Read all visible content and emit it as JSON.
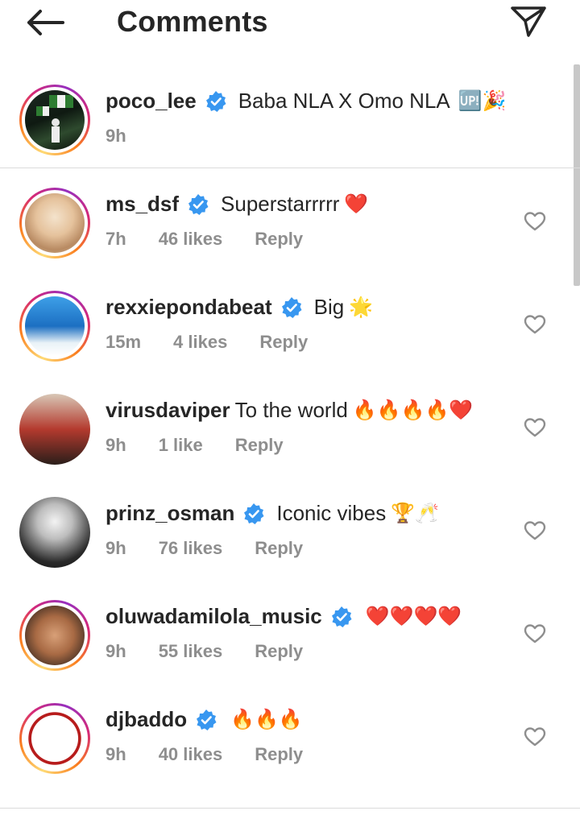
{
  "header": {
    "title": "Comments",
    "back_icon": "arrow-left-icon",
    "share_icon": "paper-plane-icon"
  },
  "caption": {
    "username": "poco_lee",
    "verified": true,
    "text": "Baba NLA X Omo NLA",
    "emojis": "🆙🎉",
    "time": "9h"
  },
  "comments": [
    {
      "username": "ms_dsf",
      "verified": true,
      "text": "Superstarrrrr",
      "emojis": "❤️",
      "time": "7h",
      "likes": "46 likes",
      "reply": "Reply"
    },
    {
      "username": "rexxiepondabeat",
      "verified": true,
      "text": "Big",
      "emojis": "🌟",
      "time": "15m",
      "likes": "4 likes",
      "reply": "Reply"
    },
    {
      "username": "virusdaviper",
      "verified": false,
      "text": "To the world",
      "emojis": "🔥🔥🔥🔥❤️",
      "time": "9h",
      "likes": "1 like",
      "reply": "Reply"
    },
    {
      "username": "prinz_osman",
      "verified": true,
      "text": "Iconic vibes",
      "emojis": "🏆🥂",
      "time": "9h",
      "likes": "76 likes",
      "reply": "Reply"
    },
    {
      "username": "oluwadamilola_music",
      "verified": true,
      "text": "",
      "emojis": "❤️❤️❤️❤️",
      "time": "9h",
      "likes": "55 likes",
      "reply": "Reply"
    },
    {
      "username": "djbaddo",
      "verified": true,
      "text": "",
      "emojis": "🔥🔥🔥",
      "time": "9h",
      "likes": "40 likes",
      "reply": "Reply"
    }
  ],
  "colors": {
    "verified_blue": "#3897f0",
    "muted_text": "#8e8e8e",
    "primary_text": "#262626",
    "divider": "#dbdbdb"
  }
}
